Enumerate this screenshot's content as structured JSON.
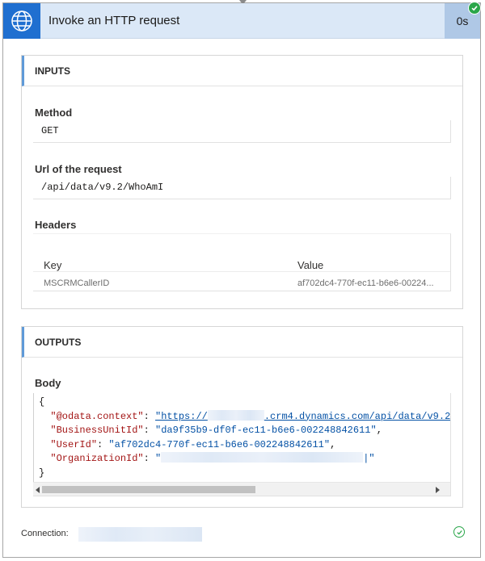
{
  "header": {
    "title": "Invoke an HTTP request",
    "duration": "0s",
    "icon": "globe-icon",
    "accent": "#1f6fd0",
    "status": "succeeded"
  },
  "inputs": {
    "section_title": "INPUTS",
    "method_label": "Method",
    "method_value": "GET",
    "url_label": "Url of the request",
    "url_value": "/api/data/v9.2/WhoAmI",
    "headers_label": "Headers",
    "headers_columns": [
      "Key",
      "Value"
    ],
    "headers_rows": [
      {
        "key": "MSCRMCallerID",
        "value": "af702dc4-770f-ec11-b6e6-00224..."
      }
    ]
  },
  "outputs": {
    "section_title": "OUTPUTS",
    "body_label": "Body",
    "body": {
      "open_brace": "{",
      "close_brace": "}",
      "lines": [
        {
          "key": "\"@odata.context\"",
          "colon": ": ",
          "value_prefix": "\"https://",
          "value_suffix": ".crm4.dynamics.com/api/data/v9.2"
        },
        {
          "key": "\"BusinessUnitId\"",
          "colon": ": ",
          "value": "\"da9f35b9-df0f-ec11-b6e6-002248842611\"",
          "trail": ","
        },
        {
          "key": "\"UserId\"",
          "colon": ": ",
          "value": "\"af702dc4-770f-ec11-b6e6-002248842611\"",
          "trail": ","
        },
        {
          "key": "\"OrganizationId\"",
          "colon": ": ",
          "value_prefix": "\"",
          "value_suffix": "|\""
        }
      ]
    }
  },
  "footer": {
    "connection_label": "Connection:",
    "status_icon": "check-circle-icon"
  }
}
